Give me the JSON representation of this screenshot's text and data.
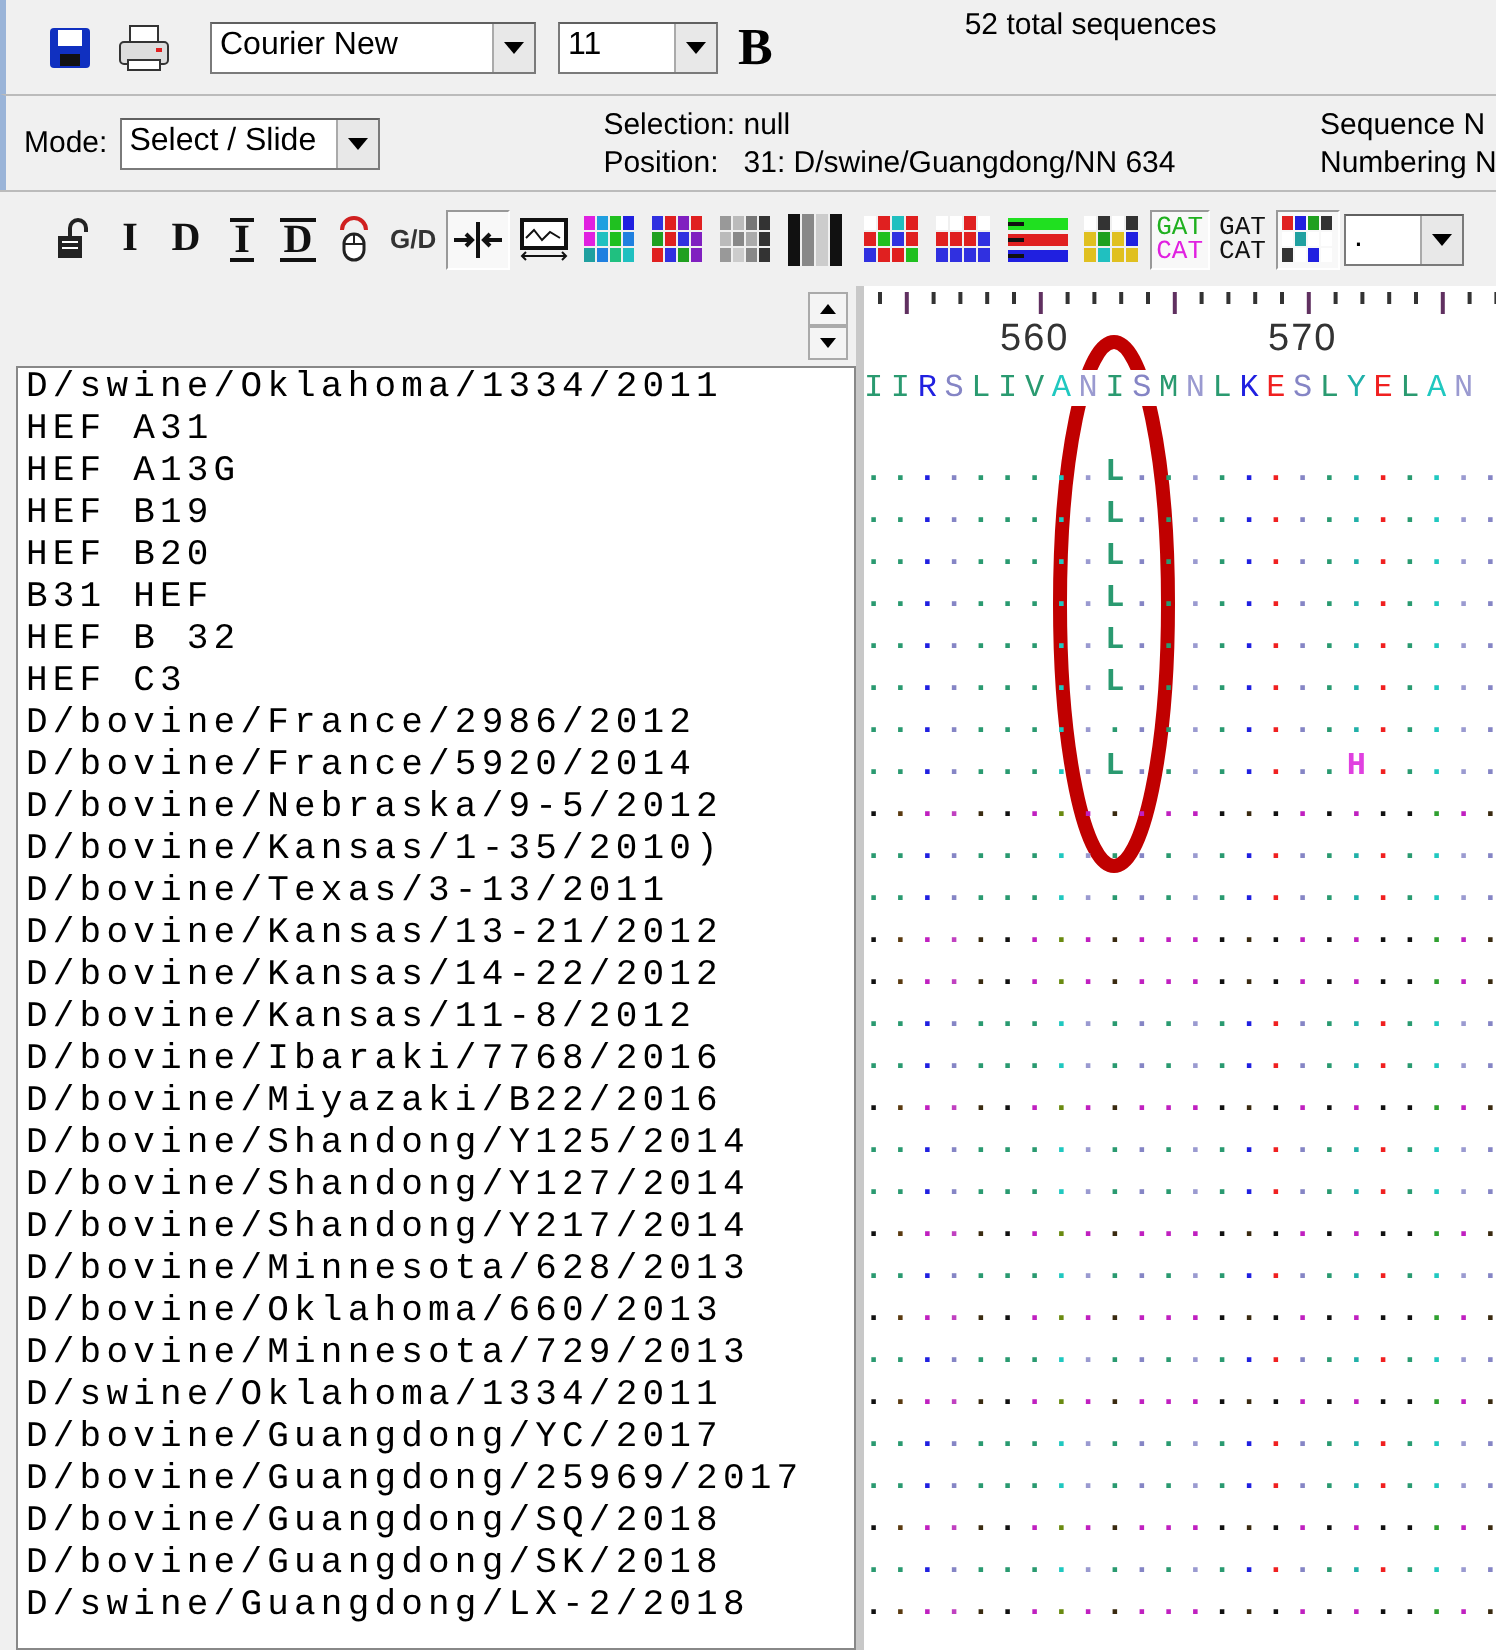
{
  "toolbar": {
    "font": "Courier New",
    "size": "11",
    "bold_button": "B",
    "total": "52 total sequences"
  },
  "status": {
    "mode_label": "Mode:",
    "mode": "Select / Slide",
    "selection_label": "Selection:",
    "selection": "null",
    "position_label": "Position:",
    "position": "31: D/swine/Guangdong/NN 634",
    "right_lines": [
      "Sequence N",
      "Numbering N"
    ]
  },
  "tools": [
    {
      "kind": "lock",
      "selected": false
    },
    {
      "kind": "letter",
      "label": "I",
      "selected": false
    },
    {
      "kind": "letter",
      "label": "D",
      "selected": false
    },
    {
      "kind": "letter-lined",
      "label": "I",
      "selected": false
    },
    {
      "kind": "letter-lined",
      "label": "D",
      "selected": false
    },
    {
      "kind": "mouse",
      "selected": false
    },
    {
      "kind": "label",
      "label": "G/D",
      "selected": false
    },
    {
      "kind": "split",
      "selected": true
    },
    {
      "kind": "graph",
      "selected": false
    },
    {
      "kind": "tiles-a",
      "selected": false
    },
    {
      "kind": "tiles-b",
      "selected": false
    },
    {
      "kind": "tiles-c",
      "selected": false
    },
    {
      "kind": "bars",
      "selected": false
    },
    {
      "kind": "tiles-d",
      "selected": false
    },
    {
      "kind": "tiles-e",
      "selected": false
    },
    {
      "kind": "stripes",
      "selected": false
    },
    {
      "kind": "tiles-f",
      "selected": false
    },
    {
      "kind": "pair-color",
      "lines": [
        "GAT",
        "CAT"
      ],
      "selected": true
    },
    {
      "kind": "pair-plain",
      "lines": [
        "GAT",
        "CAT"
      ],
      "selected": false
    },
    {
      "kind": "tiles-g",
      "selected": true
    }
  ],
  "tool_dropdown": ".",
  "ruler": {
    "labels": [
      "560",
      "570"
    ]
  },
  "annotation": {
    "kind": "ellipse"
  },
  "rows": [
    {
      "name": "D/swine/Oklahoma/1334/2011",
      "kind": "reference",
      "residues": "IIRSLIVANISMNLKESLYELAN"
    },
    {
      "name": "HEF A31"
    },
    {
      "name": "HEF A13G",
      "kind": "normal",
      "residues": ".........L.............."
    },
    {
      "name": "HEF B19",
      "kind": "normal",
      "residues": ".........L.............."
    },
    {
      "name": "HEF B20",
      "kind": "normal",
      "residues": ".........L.............."
    },
    {
      "name": "B31 HEF",
      "kind": "normal",
      "residues": ".........L.............."
    },
    {
      "name": "HEF B 32",
      "kind": "normal",
      "residues": ".........L.............."
    },
    {
      "name": "HEF C3",
      "kind": "normal",
      "residues": ".........L.............."
    },
    {
      "name": "D/bovine/France/2986/2012",
      "kind": "normal",
      "residues": "........................"
    },
    {
      "name": "D/bovine/France/5920/2014",
      "kind": "normal",
      "residues": ".........L........H....."
    },
    {
      "name": "D/bovine/Nebraska/9-5/2012",
      "kind": "alt",
      "residues": "........................"
    },
    {
      "name": "D/bovine/Kansas/1-35/2010)",
      "kind": "normal",
      "residues": "........................"
    },
    {
      "name": "D/bovine/Texas/3-13/2011",
      "kind": "normal",
      "residues": "........................"
    },
    {
      "name": "D/bovine/Kansas/13-21/2012",
      "kind": "alt",
      "residues": "........................"
    },
    {
      "name": "D/bovine/Kansas/14-22/2012",
      "kind": "alt",
      "residues": "........................"
    },
    {
      "name": "D/bovine/Kansas/11-8/2012",
      "kind": "normal",
      "residues": "........................"
    },
    {
      "name": "D/bovine/Ibaraki/7768/2016",
      "kind": "normal",
      "residues": "........................"
    },
    {
      "name": "D/bovine/Miyazaki/B22/2016",
      "kind": "alt",
      "residues": "........................"
    },
    {
      "name": "D/bovine/Shandong/Y125/2014",
      "kind": "normal",
      "residues": "........................"
    },
    {
      "name": "D/bovine/Shandong/Y127/2014",
      "kind": "normal",
      "residues": "........................"
    },
    {
      "name": "D/bovine/Shandong/Y217/2014",
      "kind": "alt",
      "residues": "........................"
    },
    {
      "name": "D/bovine/Minnesota/628/2013",
      "kind": "normal",
      "residues": "........................"
    },
    {
      "name": "D/bovine/Oklahoma/660/2013",
      "kind": "alt",
      "residues": "........................"
    },
    {
      "name": "D/bovine/Minnesota/729/2013",
      "kind": "normal",
      "residues": "........................"
    },
    {
      "name": "D/swine/Oklahoma/1334/2011",
      "kind": "alt",
      "residues": "........................"
    },
    {
      "name": "D/bovine/Guangdong/YC/2017",
      "kind": "normal",
      "residues": "........................"
    },
    {
      "name": "D/bovine/Guangdong/25969/2017",
      "kind": "normal",
      "residues": "........................"
    },
    {
      "name": "D/bovine/Guangdong/SQ/2018",
      "kind": "alt",
      "residues": "........................"
    },
    {
      "name": "D/bovine/Guangdong/SK/2018",
      "kind": "normal",
      "residues": "........................"
    },
    {
      "name": "D/swine/Guangdong/LX-2/2018",
      "kind": "alt",
      "residues": "........................"
    }
  ]
}
